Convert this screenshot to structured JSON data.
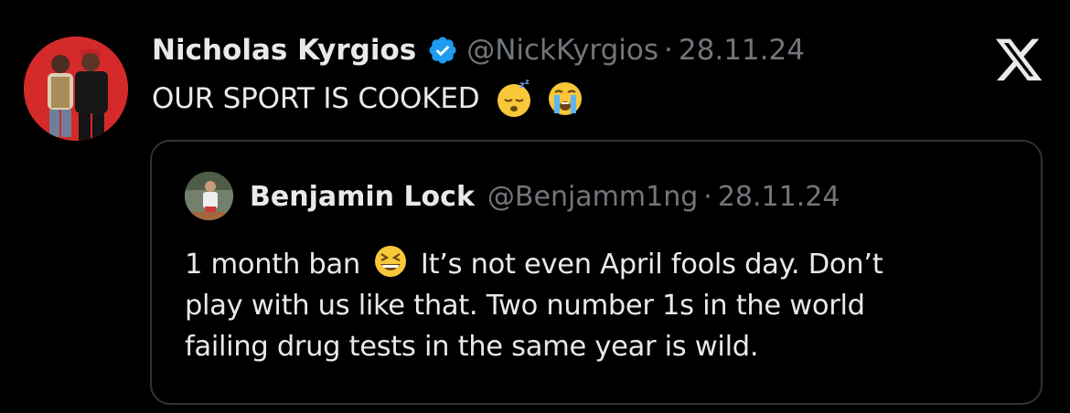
{
  "post": {
    "author_name": "Nicholas Kyrgios",
    "author_handle": "@NickKyrgios",
    "separator": "·",
    "date": "28.11.24",
    "text": "OUR SPORT IS COOKED",
    "emojis": [
      "sleeping-face",
      "loudly-crying-face"
    ]
  },
  "quoted_post": {
    "author_name": "Benjamin Lock",
    "author_handle": "@Benjamm1ng",
    "separator": "·",
    "date": "28.11.24",
    "line1_prefix": "1 month ban",
    "line1_suffix": "It’s not even April fools day. Don’t",
    "line2": "play with us like that. Two number 1s in the world",
    "line3": "failing drug tests in the same year is wild.",
    "emoji": "grinning-squinting-face"
  },
  "colors": {
    "background": "#000000",
    "text": "#e7e9ea",
    "secondary": "#71767b",
    "verified": "#1d9bf0",
    "border": "#2f3336"
  }
}
